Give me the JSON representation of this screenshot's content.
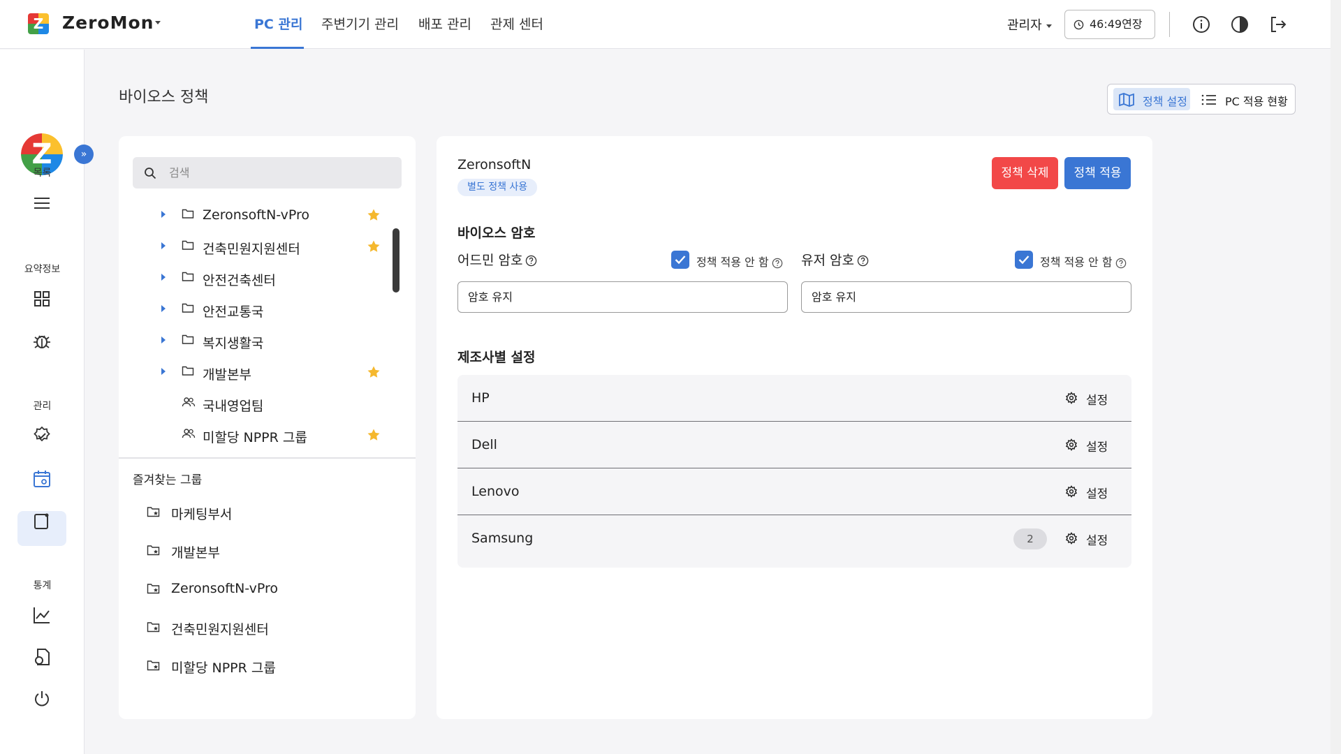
{
  "app": {
    "name": "ZeroMon"
  },
  "top_nav": {
    "tabs": [
      "PC 관리",
      "주변기기 관리",
      "배포 관리",
      "관제 센터"
    ],
    "active_tab": "PC 관리",
    "admin_label": "관리자",
    "session_timer": "46:49연장",
    "accent_color": "#3a76d4"
  },
  "sidebar": {
    "sections": [
      {
        "label": "목록",
        "icons": [
          "menu-icon"
        ]
      },
      {
        "label": "요약정보",
        "icons": [
          "grid-icon",
          "bug-icon"
        ]
      },
      {
        "label": "관리",
        "icons": [
          "badge-check-icon",
          "calendar-settings-icon",
          "clipboard-icon"
        ]
      },
      {
        "label": "통계",
        "icons": [
          "line-chart-icon",
          "document-search-icon",
          "power-icon"
        ]
      }
    ],
    "active_icon": "calendar-settings-icon"
  },
  "page": {
    "title": "바이오스 정책",
    "view_toggle": {
      "policy_settings": "정책 설정",
      "pc_status": "PC 적용 현황",
      "active": "정책 설정"
    }
  },
  "tree": {
    "search_placeholder": "검색",
    "items": [
      {
        "label": "ZeronsoftN-vPro",
        "type": "folder",
        "expandable": true,
        "favorite": true
      },
      {
        "label": "건축민원지원센터",
        "type": "folder",
        "expandable": true,
        "favorite": true
      },
      {
        "label": "안전건축센터",
        "type": "folder",
        "expandable": true,
        "favorite": false
      },
      {
        "label": "안전교통국",
        "type": "folder",
        "expandable": true,
        "favorite": false
      },
      {
        "label": "복지생활국",
        "type": "folder",
        "expandable": true,
        "favorite": false
      },
      {
        "label": "개발본부",
        "type": "folder",
        "expandable": true,
        "favorite": true
      },
      {
        "label": "국내영업팀",
        "type": "group",
        "expandable": false,
        "favorite": false
      },
      {
        "label": "미할당 NPPR 그룹",
        "type": "group",
        "expandable": false,
        "favorite": true
      }
    ],
    "favorites_title": "즐겨찾는 그룹",
    "favorites": [
      "마케팅부서",
      "개발본부",
      "ZeronsoftN-vPro",
      "건축민원지원센터",
      "미할당 NPPR 그룹"
    ]
  },
  "detail": {
    "org_name": "ZeronsoftN",
    "badge": "별도 정책 사용",
    "delete_button": "정책 삭제",
    "apply_button": "정책 적용",
    "bios_password_title": "바이오스 암호",
    "admin_password_label": "어드민 암호",
    "user_password_label": "유저 암호",
    "no_policy_label": "정책 적용 안 함",
    "admin_no_policy_checked": true,
    "user_no_policy_checked": true,
    "admin_password_value": "암호 유지",
    "user_password_value": "암호 유지",
    "manufacturer_title": "제조사별 설정",
    "settings_label": "설정",
    "manufacturers": [
      {
        "name": "HP",
        "count": null
      },
      {
        "name": "Dell",
        "count": null
      },
      {
        "name": "Lenovo",
        "count": null
      },
      {
        "name": "Samsung",
        "count": "2"
      }
    ]
  }
}
